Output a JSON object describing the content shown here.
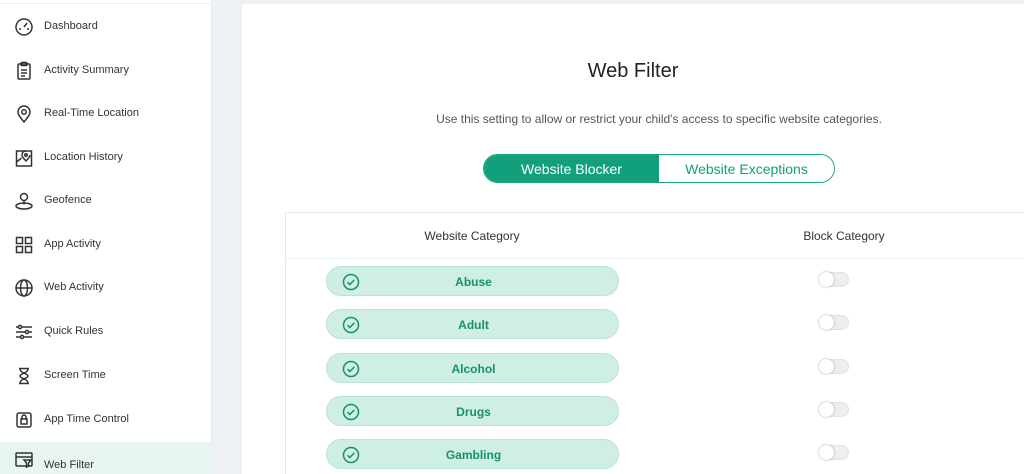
{
  "sidebar": {
    "items": [
      {
        "label": "Dashboard",
        "icon": "gauge-icon"
      },
      {
        "label": "Activity Summary",
        "icon": "clipboard-icon"
      },
      {
        "label": "Real-Time Location",
        "icon": "location-pin-icon"
      },
      {
        "label": "Location History",
        "icon": "map-pin-icon"
      },
      {
        "label": "Geofence",
        "icon": "geofence-icon"
      },
      {
        "label": "App Activity",
        "icon": "grid-icon"
      },
      {
        "label": "Web Activity",
        "icon": "globe-icon"
      },
      {
        "label": "Quick Rules",
        "icon": "sliders-icon"
      },
      {
        "label": "Screen Time",
        "icon": "hourglass-icon"
      },
      {
        "label": "App Time Control",
        "icon": "lock-icon"
      },
      {
        "label": "Web Filter",
        "icon": "web-filter-icon",
        "active": true
      }
    ]
  },
  "main": {
    "title": "Web Filter",
    "subtitle": "Use this setting to allow or restrict your child's access to specific website categories.",
    "tabs": [
      {
        "label": "Website Blocker",
        "active": true
      },
      {
        "label": "Website Exceptions",
        "active": false
      }
    ],
    "table": {
      "headers": {
        "category": "Website Category",
        "block": "Block Category"
      },
      "rows": [
        {
          "name": "Abuse",
          "blocked": false
        },
        {
          "name": "Adult",
          "blocked": false
        },
        {
          "name": "Alcohol",
          "blocked": false
        },
        {
          "name": "Drugs",
          "blocked": false
        },
        {
          "name": "Gambling",
          "blocked": false
        }
      ]
    }
  },
  "colors": {
    "accent": "#129f7b",
    "pill_bg": "#cfeee4",
    "active_nav_bg": "#e7f4f0"
  }
}
